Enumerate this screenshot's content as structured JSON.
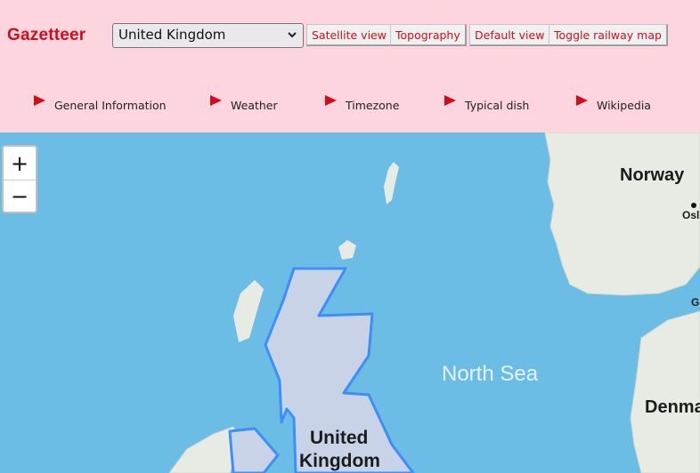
{
  "app": {
    "brand": "Gazetteer"
  },
  "country_select": {
    "value": "United Kingdom"
  },
  "toolbar": {
    "satellite": "Satellite view",
    "topography": "Topography",
    "default": "Default view",
    "railway": "Toggle railway map"
  },
  "tabs": [
    {
      "label": "General Information"
    },
    {
      "label": "Weather"
    },
    {
      "label": "Timezone"
    },
    {
      "label": "Typical dish"
    },
    {
      "label": "Wikipedia"
    }
  ],
  "zoom": {
    "in": "+",
    "out": "−"
  },
  "map": {
    "labels": {
      "norway": "Norway",
      "oslo": "Oslo",
      "north_sea": "North Sea",
      "uk_line1": "United",
      "uk_line2": "Kingdom",
      "denmark": "Denmark",
      "g": "G"
    }
  },
  "colors": {
    "accent": "#d10d1c",
    "header_bg": "#fcd5df",
    "sea": "#6bbde6",
    "land": "#e9ece6",
    "highlight_fill": "#c4d2e8",
    "highlight_stroke": "#3d8ff5"
  }
}
